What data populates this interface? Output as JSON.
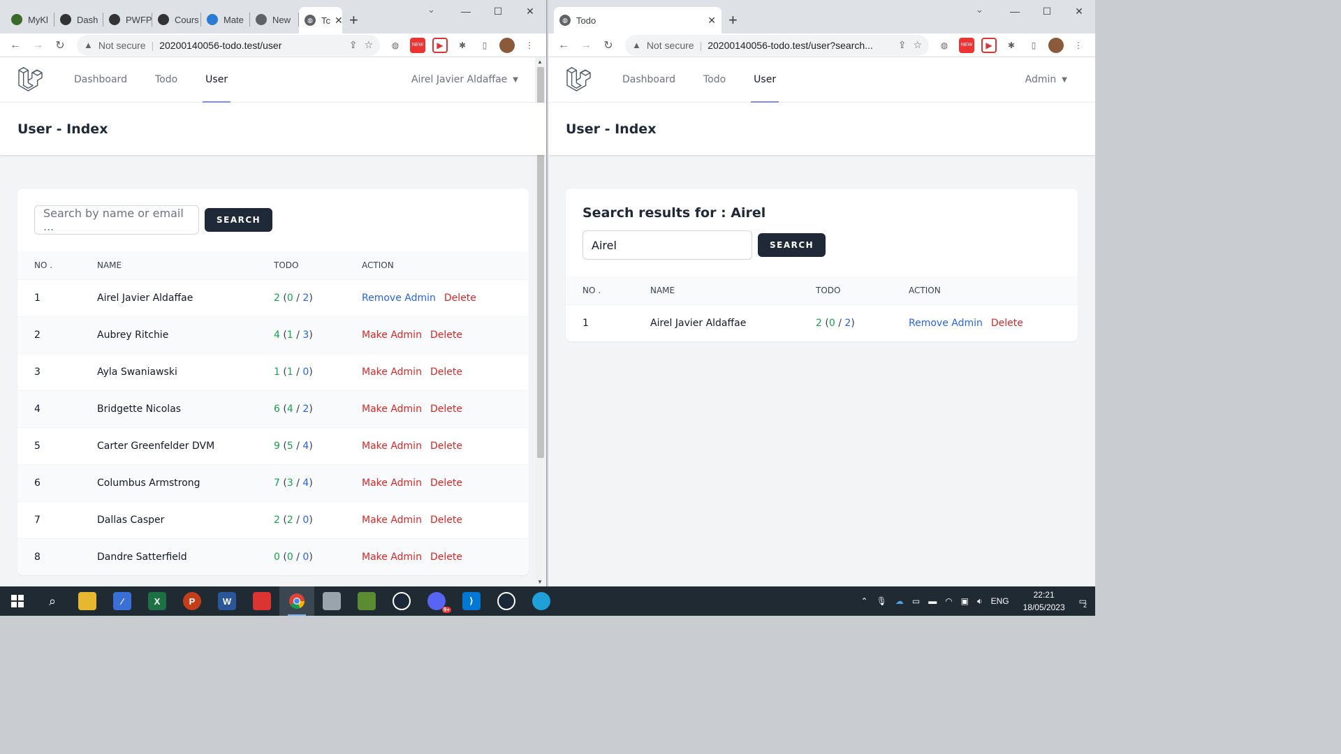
{
  "left_window": {
    "tabs": [
      {
        "label": "MyKl",
        "color": "#3a6b2a"
      },
      {
        "label": "Dash",
        "color": "#333"
      },
      {
        "label": "PWFP",
        "color": "#333"
      },
      {
        "label": "Cours",
        "color": "#333"
      },
      {
        "label": "Mate",
        "color": "#2a7bd6"
      },
      {
        "label": "New",
        "color": "#5f6368"
      }
    ],
    "active_tab": "Tc",
    "omnibox": {
      "security": "Not secure",
      "url": "20200140056-todo.test/user"
    },
    "app": {
      "nav": {
        "dashboard": "Dashboard",
        "todo": "Todo",
        "user": "User",
        "account": "Airel Javier Aldaffae"
      },
      "page_title": "User - Index",
      "search": {
        "placeholder": "Search by name or email ...",
        "button": "SEARCH"
      },
      "table": {
        "headers": {
          "no": "NO .",
          "name": "NAME",
          "todo": "TODO",
          "action": "ACTION"
        },
        "rows": [
          {
            "no": "1",
            "name": "Airel Javier Aldaffae",
            "total": "2",
            "a": "0",
            "b": "2",
            "admin_action": "Remove Admin",
            "admin_kind": "remove",
            "delete": "Delete"
          },
          {
            "no": "2",
            "name": "Aubrey Ritchie",
            "total": "4",
            "a": "1",
            "b": "3",
            "admin_action": "Make Admin",
            "admin_kind": "make",
            "delete": "Delete"
          },
          {
            "no": "3",
            "name": "Ayla Swaniawski",
            "total": "1",
            "a": "1",
            "b": "0",
            "admin_action": "Make Admin",
            "admin_kind": "make",
            "delete": "Delete"
          },
          {
            "no": "4",
            "name": "Bridgette Nicolas",
            "total": "6",
            "a": "4",
            "b": "2",
            "admin_action": "Make Admin",
            "admin_kind": "make",
            "delete": "Delete"
          },
          {
            "no": "5",
            "name": "Carter Greenfelder DVM",
            "total": "9",
            "a": "5",
            "b": "4",
            "admin_action": "Make Admin",
            "admin_kind": "make",
            "delete": "Delete"
          },
          {
            "no": "6",
            "name": "Columbus Armstrong",
            "total": "7",
            "a": "3",
            "b": "4",
            "admin_action": "Make Admin",
            "admin_kind": "make",
            "delete": "Delete"
          },
          {
            "no": "7",
            "name": "Dallas Casper",
            "total": "2",
            "a": "2",
            "b": "0",
            "admin_action": "Make Admin",
            "admin_kind": "make",
            "delete": "Delete"
          },
          {
            "no": "8",
            "name": "Dandre Satterfield",
            "total": "0",
            "a": "0",
            "b": "0",
            "admin_action": "Make Admin",
            "admin_kind": "make",
            "delete": "Delete"
          }
        ]
      }
    }
  },
  "right_window": {
    "active_tab": "Todo",
    "omnibox": {
      "security": "Not secure",
      "url": "20200140056-todo.test/user?search..."
    },
    "app": {
      "nav": {
        "dashboard": "Dashboard",
        "todo": "Todo",
        "user": "User",
        "account": "Admin"
      },
      "page_title": "User - Index",
      "results_heading": "Search results for : Airel",
      "search": {
        "value": "Airel",
        "button": "SEARCH"
      },
      "table": {
        "headers": {
          "no": "NO .",
          "name": "NAME",
          "todo": "TODO",
          "action": "ACTION"
        },
        "rows": [
          {
            "no": "1",
            "name": "Airel Javier Aldaffae",
            "total": "2",
            "a": "0",
            "b": "2",
            "admin_action": "Remove Admin",
            "admin_kind": "remove",
            "delete": "Delete"
          }
        ]
      }
    }
  },
  "browser_ui": {
    "extension_badge": "NEW"
  },
  "taskbar": {
    "language": "ENG",
    "time": "22:21",
    "date": "18/05/2023",
    "notifications": "2",
    "badge": "9+"
  }
}
